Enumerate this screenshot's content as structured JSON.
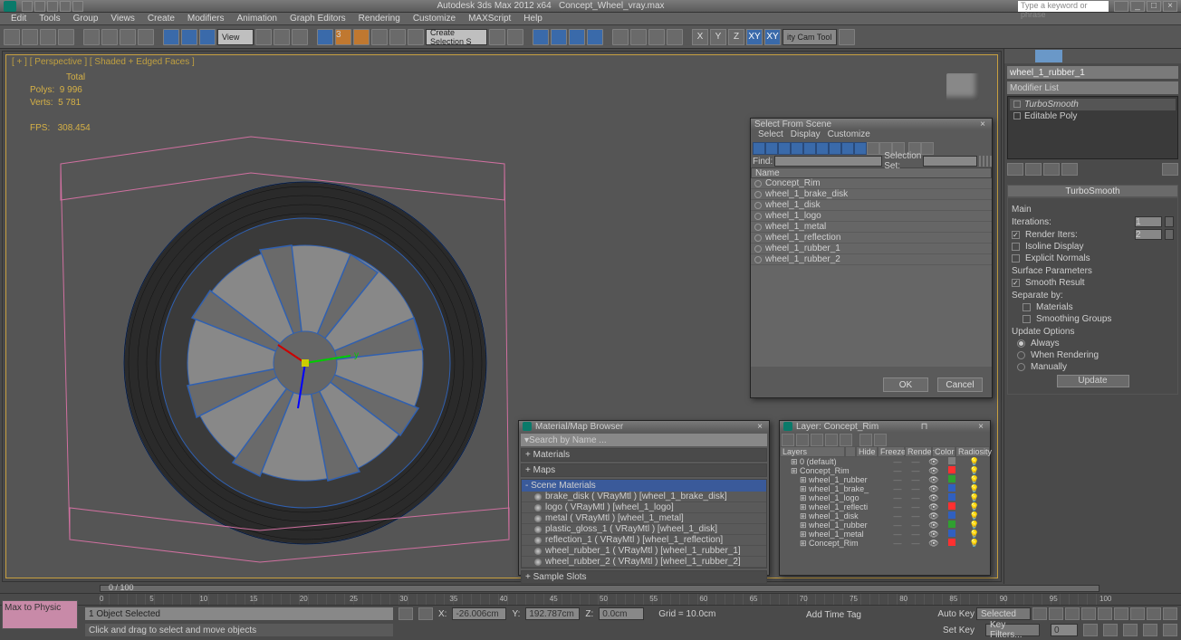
{
  "app": {
    "title": "Autodesk 3ds Max  2012 x64",
    "filename": "Concept_Wheel_vray.max",
    "search_placeholder": "Type a keyword or phrase"
  },
  "menu": [
    "Edit",
    "Tools",
    "Group",
    "Views",
    "Create",
    "Modifiers",
    "Animation",
    "Graph Editors",
    "Rendering",
    "Customize",
    "MAXScript",
    "Help"
  ],
  "toolbar": {
    "view_label": "View",
    "snap_dropdown": "Create Selection S",
    "cam_tool": "ity Cam Tool",
    "axes": [
      "X",
      "Y",
      "Z",
      "XY",
      "XY"
    ]
  },
  "viewport": {
    "label": "[ + ] [ Perspective ] [ Shaded + Edged Faces ]",
    "stats": {
      "total_label": "Total",
      "polys_label": "Polys:",
      "polys_value": "9 996",
      "verts_label": "Verts:",
      "verts_value": "5 781",
      "fps_label": "FPS:",
      "fps_value": "308.454"
    }
  },
  "command_panel": {
    "object_name": "wheel_1_rubber_1",
    "modifier_list_label": "Modifier List",
    "stack": [
      "TurboSmooth",
      "Editable Poly"
    ],
    "rollout_title": "TurboSmooth",
    "main_label": "Main",
    "iterations_label": "Iterations:",
    "iterations_value": "1",
    "render_iters_label": "Render Iters:",
    "render_iters_value": "2",
    "isoline_label": "Isoline Display",
    "explicit_label": "Explicit Normals",
    "surface_params_label": "Surface Parameters",
    "smooth_result_label": "Smooth Result",
    "separate_label": "Separate by:",
    "materials_label": "Materials",
    "smoothing_groups_label": "Smoothing Groups",
    "update_options_label": "Update Options",
    "always_label": "Always",
    "when_rendering_label": "When Rendering",
    "manually_label": "Manually",
    "update_button": "Update"
  },
  "select_from_scene": {
    "title": "Select From Scene",
    "menu": [
      "Select",
      "Display",
      "Customize"
    ],
    "find_label": "Find:",
    "selset_label": "Selection Set:",
    "name_header": "Name",
    "items": [
      "Concept_Rim",
      "wheel_1_brake_disk",
      "wheel_1_disk",
      "wheel_1_logo",
      "wheel_1_metal",
      "wheel_1_reflection",
      "wheel_1_rubber_1",
      "wheel_1_rubber_2"
    ],
    "ok": "OK",
    "cancel": "Cancel"
  },
  "material_browser": {
    "title": "Material/Map Browser",
    "search_placeholder": "Search by Name ...",
    "sections": {
      "materials": "+ Materials",
      "maps": "+ Maps",
      "scene": "- Scene Materials",
      "sample": "+ Sample Slots"
    },
    "scene_materials": [
      "brake_disk ( VRayMtl ) [wheel_1_brake_disk]",
      "logo ( VRayMtl ) [wheel_1_logo]",
      "metal ( VRayMtl ) [wheel_1_metal]",
      "plastic_gloss_1 ( VRayMtl ) [wheel_1_disk]",
      "reflection_1 ( VRayMtl ) [wheel_1_reflection]",
      "wheel_rubber_1 ( VRayMtl ) [wheel_1_rubber_1]",
      "wheel_rubber_2 ( VRayMtl ) [wheel_1_rubber_2]"
    ]
  },
  "layer_manager": {
    "title": "Layer: Concept_Rim",
    "columns": [
      "Layers",
      "",
      "Hide",
      "Freeze",
      "Render",
      "Color",
      "Radiosity"
    ],
    "rows": [
      {
        "name": "0 (default)",
        "indent": 0,
        "color": "#808080"
      },
      {
        "name": "Concept_Rim",
        "indent": 0,
        "color": "#ff3030"
      },
      {
        "name": "wheel_1_rubber",
        "indent": 1,
        "color": "#30a030"
      },
      {
        "name": "wheel_1_brake_",
        "indent": 1,
        "color": "#3060c0"
      },
      {
        "name": "wheel_1_logo",
        "indent": 1,
        "color": "#3060c0"
      },
      {
        "name": "wheel_1_reflecti",
        "indent": 1,
        "color": "#ff3030"
      },
      {
        "name": "wheel_1_disk",
        "indent": 1,
        "color": "#3060c0"
      },
      {
        "name": "wheel_1_rubber",
        "indent": 1,
        "color": "#30a030"
      },
      {
        "name": "wheel_1_metal",
        "indent": 1,
        "color": "#3060c0"
      },
      {
        "name": "Concept_Rim",
        "indent": 1,
        "color": "#ff3030"
      }
    ]
  },
  "timeline": {
    "frame_range": "0 / 100",
    "ticks": [
      0,
      5,
      10,
      15,
      20,
      25,
      30,
      35,
      40,
      45,
      50,
      55,
      60,
      65,
      70,
      75,
      80,
      85,
      90,
      95,
      100
    ]
  },
  "status": {
    "max_to_physic": "Max to Physic",
    "selection_info": "1 Object Selected",
    "prompt": "Click and drag to select and move objects",
    "x_label": "X:",
    "x_value": "-26.006cm",
    "y_label": "Y:",
    "y_value": "192.787cm",
    "z_label": "Z:",
    "z_value": "0.0cm",
    "grid": "Grid = 10.0cm",
    "add_time_tag": "Add Time Tag",
    "auto_key": "Auto Key",
    "set_key": "Set Key",
    "selected": "Selected",
    "key_filters": "Key Filters..."
  }
}
